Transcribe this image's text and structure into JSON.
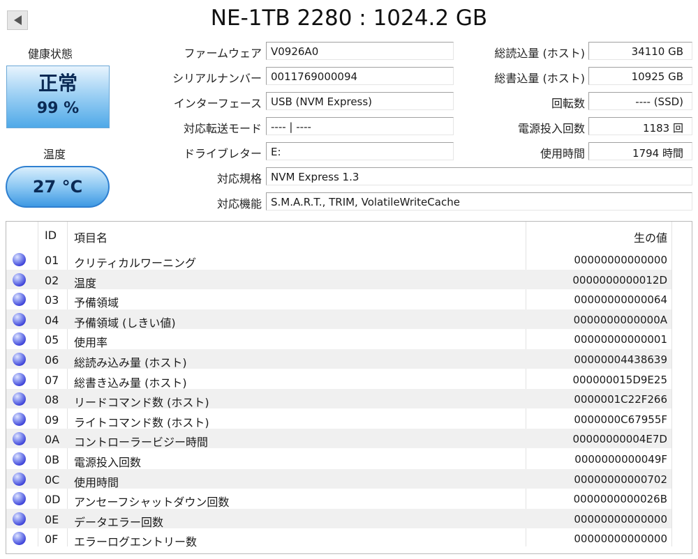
{
  "title": "NE-1TB 2280 : 1024.2 GB",
  "health": {
    "label": "健康状態",
    "status": "正常",
    "percent": "99 %"
  },
  "temperature": {
    "label": "温度",
    "value": "27 °C"
  },
  "fields_left": [
    {
      "label": "ファームウェア",
      "value": "V0926A0"
    },
    {
      "label": "シリアルナンバー",
      "value": "0011769000094"
    },
    {
      "label": "インターフェース",
      "value": "USB (NVM Express)"
    },
    {
      "label": "対応転送モード",
      "value": "---- | ----"
    },
    {
      "label": "ドライブレター",
      "value": "E:"
    }
  ],
  "fields_right": [
    {
      "label": "総読込量 (ホスト)",
      "value": "34110 GB"
    },
    {
      "label": "総書込量 (ホスト)",
      "value": "10925 GB"
    },
    {
      "label": "回転数",
      "value": "---- (SSD)"
    },
    {
      "label": "電源投入回数",
      "value": "1183 回"
    },
    {
      "label": "使用時間",
      "value": "1794 時間"
    }
  ],
  "fields_wide": [
    {
      "label": "対応規格",
      "value": "NVM Express 1.3"
    },
    {
      "label": "対応機能",
      "value": "S.M.A.R.T., TRIM, VolatileWriteCache"
    }
  ],
  "table": {
    "headers": {
      "id": "ID",
      "name": "項目名",
      "raw": "生の値"
    },
    "rows": [
      {
        "id": "01",
        "name": "クリティカルワーニング",
        "raw": "00000000000000"
      },
      {
        "id": "02",
        "name": "温度",
        "raw": "0000000000012D"
      },
      {
        "id": "03",
        "name": "予備領域",
        "raw": "00000000000064"
      },
      {
        "id": "04",
        "name": "予備領域 (しきい値)",
        "raw": "0000000000000A"
      },
      {
        "id": "05",
        "name": "使用率",
        "raw": "00000000000001"
      },
      {
        "id": "06",
        "name": "総読み込み量 (ホスト)",
        "raw": "00000004438639"
      },
      {
        "id": "07",
        "name": "総書き込み量 (ホスト)",
        "raw": "000000015D9E25"
      },
      {
        "id": "08",
        "name": "リードコマンド数 (ホスト)",
        "raw": "0000001C22F266"
      },
      {
        "id": "09",
        "name": "ライトコマンド数 (ホスト)",
        "raw": "0000000C67955F"
      },
      {
        "id": "0A",
        "name": "コントローラービジー時間",
        "raw": "00000000004E7D"
      },
      {
        "id": "0B",
        "name": "電源投入回数",
        "raw": "0000000000049F"
      },
      {
        "id": "0C",
        "name": "使用時間",
        "raw": "00000000000702"
      },
      {
        "id": "0D",
        "name": "アンセーフシャットダウン回数",
        "raw": "0000000000026B"
      },
      {
        "id": "0E",
        "name": "データエラー回数",
        "raw": "00000000000000"
      },
      {
        "id": "0F",
        "name": "エラーログエントリー数",
        "raw": "00000000000000"
      }
    ]
  },
  "icons": {
    "prev": "triangle-left-icon",
    "status_dot": "blue-status-dot-icon"
  },
  "colors": {
    "health_accent": "#4fa9e8",
    "status_dot": "#3a3fd8"
  }
}
